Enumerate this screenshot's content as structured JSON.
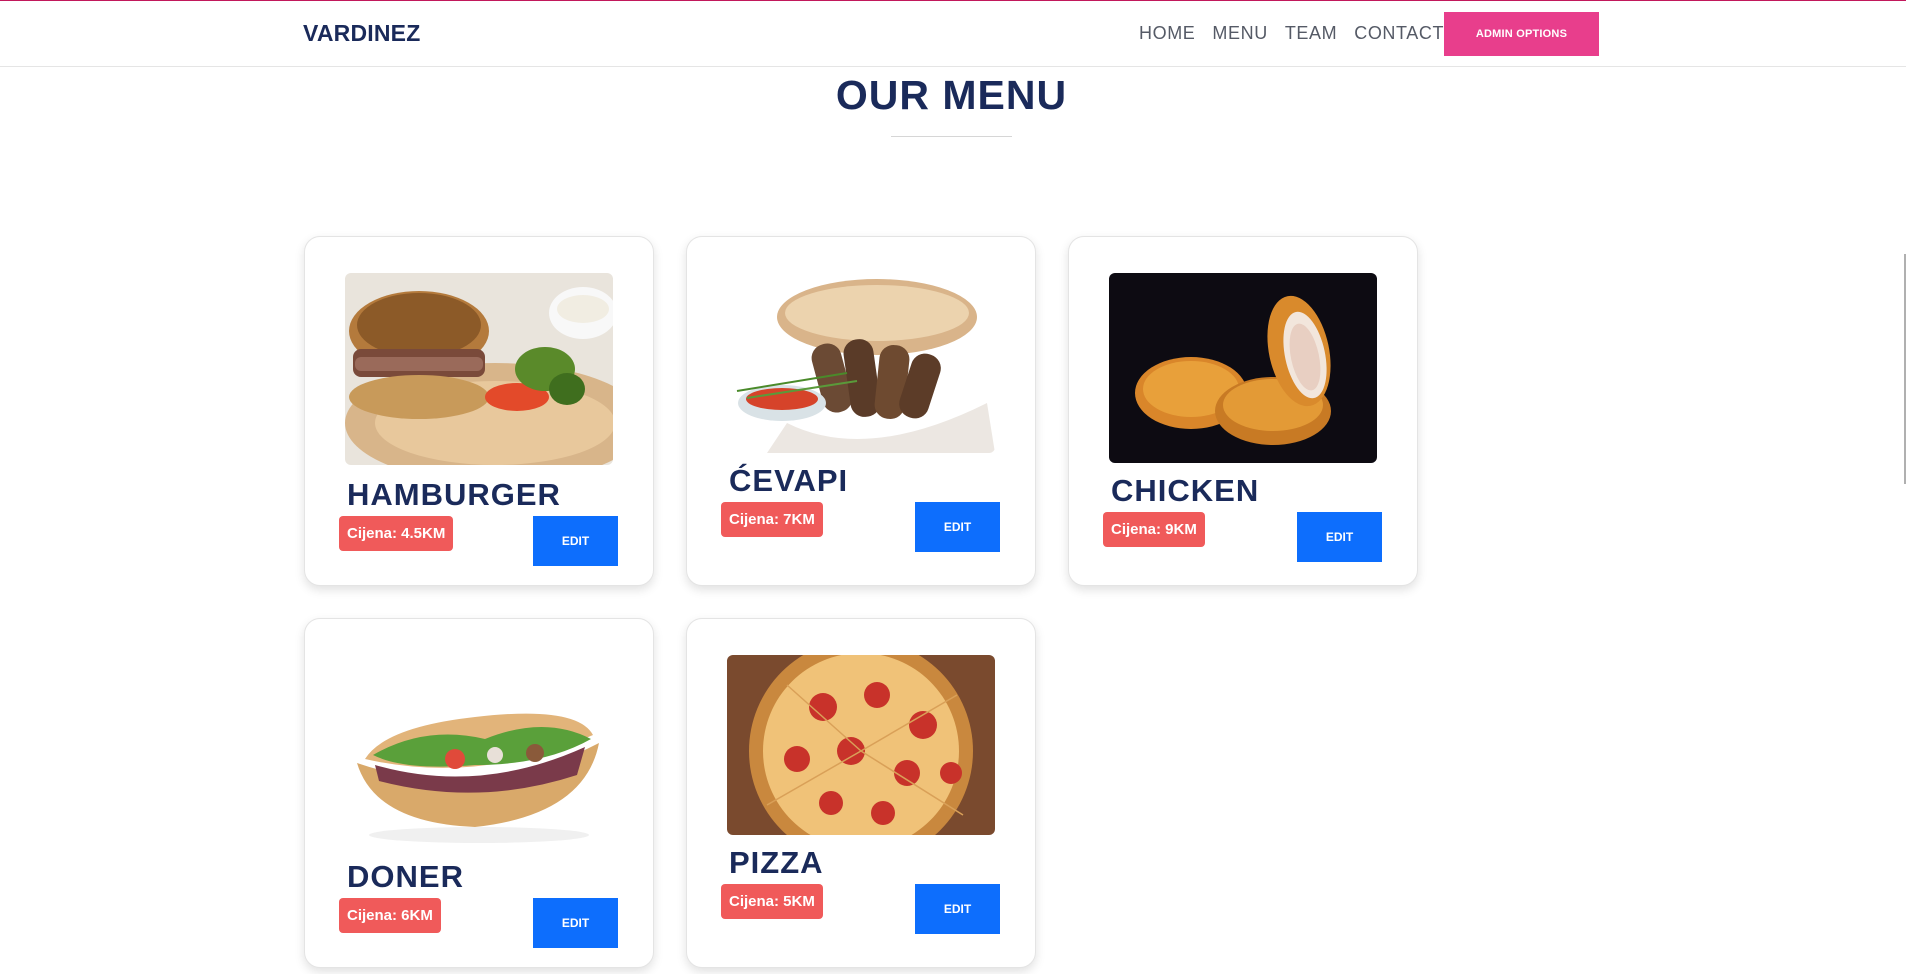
{
  "navbar": {
    "brand": "VARDINEZ",
    "links": [
      "HOME",
      "MENU",
      "TEAM",
      "CONTACT"
    ],
    "admin_button": "ADMIN OPTIONS"
  },
  "section": {
    "title": "OUR MENU"
  },
  "menu": {
    "items": [
      {
        "name": "HAMBURGER",
        "price": "Cijena: 4.5KM",
        "edit_label": "EDIT",
        "image": "hamburger-photo"
      },
      {
        "name": "ĆEVAPI",
        "price": "Cijena: 7KM",
        "edit_label": "EDIT",
        "image": "cevapi-photo"
      },
      {
        "name": "CHICKEN",
        "price": "Cijena: 9KM",
        "edit_label": "EDIT",
        "image": "chicken-nuggets-photo"
      },
      {
        "name": "DONER",
        "price": "Cijena: 6KM",
        "edit_label": "EDIT",
        "image": "doner-photo"
      },
      {
        "name": "PIZZA",
        "price": "Cijena: 5KM",
        "edit_label": "EDIT",
        "image": "pizza-photo"
      }
    ]
  },
  "colors": {
    "brand_navy": "#1a2a5a",
    "admin_pink": "#e83e8c",
    "edit_blue": "#0d6efd",
    "price_red": "#f05a5a"
  }
}
